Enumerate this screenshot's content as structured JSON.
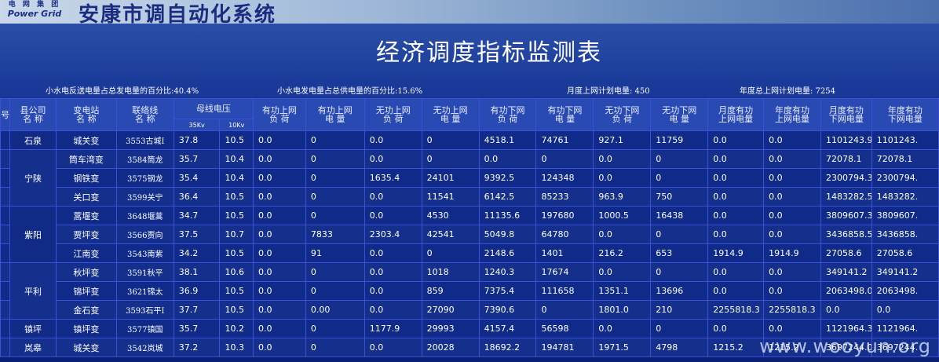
{
  "header": {
    "logo_line1": "电 网 集 团",
    "logo_line2": "Power Grid",
    "system_title": "安康市调自动化系统"
  },
  "page": {
    "title": "经济调度指标监测表"
  },
  "summary": {
    "s1": "小水电反送电量占总发电量的百分比:40.4%",
    "s2": "小水电发电量占总供电量的百分比:15.6%",
    "s3": "月度上网计划电量: 450",
    "s4": "年度总上网计划电量: 7254"
  },
  "table": {
    "headers": {
      "seq": "号",
      "county": "县公司\n名 称",
      "station": "变电站\n名 称",
      "line": "联络线\n名 称",
      "bus_voltage": "母线电压",
      "kv35": "35Kv",
      "kv10": "10Kv",
      "p_up_load": "有功上网\n负 荷",
      "p_up_energy": "有功上网\n电 量",
      "q_up_load": "无功上网\n负 荷",
      "q_up_energy": "无功上网\n电 量",
      "p_down_load": "有功下网\n负 荷",
      "p_down_energy": "有功下网\n电 量",
      "q_down_load": "无功下网\n负 荷",
      "q_down_energy": "无功下网\n电 量",
      "month_p_up": "月度有功\n上网电量",
      "year_p_up": "年度有功\n上网电量",
      "month_p_down": "月度有功\n下网电量",
      "year_p_down": "年度有功\n下网电量"
    },
    "counties": [
      "石泉",
      "宁陕",
      "紫阳",
      "平利",
      "镇坪",
      "岚皋"
    ],
    "rows": [
      [
        "城关变",
        "3553古城I",
        "37.8",
        "10.5",
        "0.0",
        "0",
        "0.0",
        "0",
        "4518.1",
        "74761",
        "927.1",
        "11759",
        "0.0",
        "0.0",
        "1101243.9",
        "1101243."
      ],
      [
        "筒车湾变",
        "3584筒龙",
        "35.7",
        "10.4",
        "0.0",
        "0",
        "0.0",
        "0",
        "0.0",
        "0",
        "0.0",
        "0",
        "0.0",
        "0.0",
        "72078.1",
        "72078.1"
      ],
      [
        "钢铁变",
        "3575钢龙",
        "35.4",
        "10.4",
        "0.0",
        "0",
        "1635.4",
        "24101",
        "9392.5",
        "124348",
        "0.0",
        "0",
        "0.0",
        "0.0",
        "2300794.3",
        "2300794."
      ],
      [
        "关口变",
        "3599关宁",
        "36.4",
        "10.5",
        "0.0",
        "0",
        "0.0",
        "11541",
        "6142.5",
        "85233",
        "963.9",
        "750",
        "0.0",
        "0.0",
        "1483282.5",
        "1483282."
      ],
      [
        "蒿堰变",
        "3648堰蒿",
        "34.7",
        "10.5",
        "0.0",
        "0",
        "0.0",
        "4530",
        "11135.6",
        "197680",
        "1000.5",
        "16438",
        "0.0",
        "0.0",
        "3809607.3",
        "3809607."
      ],
      [
        "贾坪变",
        "3566贾向",
        "37.5",
        "10.7",
        "0.0",
        "7833",
        "2303.4",
        "42541",
        "5049.8",
        "64780",
        "0.0",
        "0",
        "0.0",
        "0.0",
        "3436858.5",
        "3436858."
      ],
      [
        "江南变",
        "3543南紫",
        "34.2",
        "10.5",
        "0.0",
        "91",
        "0.0",
        "0",
        "2148.6",
        "1401",
        "216.2",
        "653",
        "1914.9",
        "1914.9",
        "27058.6",
        "27058.6"
      ],
      [
        "秋坪变",
        "3591秋平",
        "38.1",
        "10.6",
        "0.0",
        "0",
        "0.0",
        "1018",
        "1240.3",
        "17674",
        "0.0",
        "0",
        "0.0",
        "0.0",
        "349141.2",
        "349141.2"
      ],
      [
        "锦坪变",
        "3621锦太",
        "36.9",
        "10.5",
        "0.0",
        "0",
        "0.0",
        "859",
        "7375.4",
        "111658",
        "1351.1",
        "13696",
        "0.0",
        "0.0",
        "2063498.0",
        "2063498."
      ],
      [
        "金石变",
        "3593石平I",
        "37.7",
        "10.5",
        "0.0",
        "0.00",
        "0.0",
        "27090",
        "7390.6",
        "0",
        "1801.0",
        "210",
        "2255818.3",
        "2255818.3",
        "0.0",
        "0.0"
      ],
      [
        "镇坪变",
        "3577镇国",
        "35.7",
        "10.2",
        "0.0",
        "0",
        "1177.9",
        "29993",
        "4157.4",
        "56598",
        "0.0",
        "0",
        "0.0",
        "0.0",
        "1121964.3",
        "1121964."
      ],
      [
        "城关变",
        "3542岚城",
        "37.2",
        "10.3",
        "0.0",
        "0",
        "0.0",
        "20028",
        "18692.2",
        "194781",
        "1971.5",
        "4798",
        "1215.2",
        "1215.2",
        "3697244.0",
        "3697244."
      ]
    ]
  },
  "watermark": "www.wooyun.org"
}
